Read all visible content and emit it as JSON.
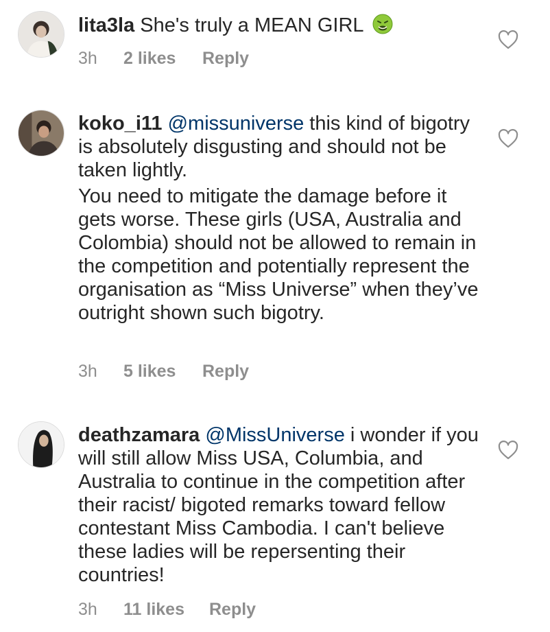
{
  "comments": [
    {
      "username": "lita3la",
      "mention": "",
      "text": " She's truly a MEAN GIRL",
      "emoji": "nauseated-face-emoji",
      "text2": "",
      "time": "3h",
      "likes": "2 likes",
      "reply": "Reply"
    },
    {
      "username": "koko_i11",
      "mention": "@missuniverse",
      "text": " this kind of bigotry is absolutely disgusting and should not be taken lightly.",
      "text2": "You need to mitigate the damage before it gets worse. These girls (USA, Australia and Colombia) should not be allowed to remain in the competition and potentially represent the organisation as “Miss Universe” when they’ve outright shown such bigotry.",
      "time": "3h",
      "likes": "5 likes",
      "reply": "Reply"
    },
    {
      "username": "deathzamara",
      "mention": "@MissUniverse",
      "text": " i wonder if you will still allow Miss USA, Columbia, and Australia to continue in the competition after their racist/ bigoted remarks toward fellow contestant Miss Cambodia. I can't believe these ladies will be repersenting their countries!",
      "text2": "",
      "time": "3h",
      "likes": "11 likes",
      "reply": "Reply"
    }
  ],
  "icons": {
    "like": "heart-outline-icon",
    "avatar": "user-avatar"
  },
  "colors": {
    "text": "#262626",
    "mention": "#003569",
    "meta": "#8e8e8e",
    "heart": "#8e8e8e"
  }
}
